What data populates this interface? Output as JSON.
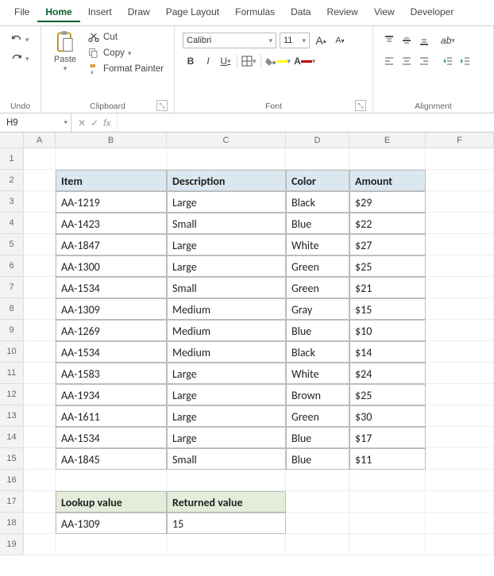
{
  "menu": {
    "tabs": [
      "File",
      "Home",
      "Insert",
      "Draw",
      "Page Layout",
      "Formulas",
      "Data",
      "Review",
      "View",
      "Developer"
    ],
    "active": "Home"
  },
  "ribbon": {
    "undo": {
      "label": "Undo"
    },
    "clipboard": {
      "paste": "Paste",
      "cut": "Cut",
      "copy": "Copy",
      "format_painter": "Format Painter",
      "label": "Clipboard"
    },
    "font": {
      "name": "Calibri",
      "size": "11",
      "label": "Font",
      "fill_color": "#ffff00",
      "font_color": "#c00000"
    },
    "alignment": {
      "label": "Alignment"
    }
  },
  "formula_bar": {
    "name_box": "H9",
    "fx": "fx",
    "value": ""
  },
  "columns": [
    "A",
    "B",
    "C",
    "D",
    "E",
    "F"
  ],
  "rows": [
    "1",
    "2",
    "3",
    "4",
    "5",
    "6",
    "7",
    "8",
    "9",
    "10",
    "11",
    "12",
    "13",
    "14",
    "15",
    "16",
    "17",
    "18",
    "19"
  ],
  "table_headers": [
    "Item",
    "Description",
    "Color",
    "Amount"
  ],
  "table": [
    [
      "AA-1219",
      "Large",
      "Black",
      "$29"
    ],
    [
      "AA-1423",
      "Small",
      "Blue",
      "$22"
    ],
    [
      "AA-1847",
      "Large",
      "White",
      "$27"
    ],
    [
      "AA-1300",
      "Large",
      "Green",
      "$25"
    ],
    [
      "AA-1534",
      "Small",
      "Green",
      "$21"
    ],
    [
      "AA-1309",
      "Medium",
      "Gray",
      "$15"
    ],
    [
      "AA-1269",
      "Medium",
      "Blue",
      "$10"
    ],
    [
      "AA-1534",
      "Medium",
      "Black",
      "$14"
    ],
    [
      "AA-1583",
      "Large",
      "White",
      "$24"
    ],
    [
      "AA-1934",
      "Large",
      "Brown",
      "$25"
    ],
    [
      "AA-1611",
      "Large",
      "Green",
      "$30"
    ],
    [
      "AA-1534",
      "Large",
      "Blue",
      "$17"
    ],
    [
      "AA-1845",
      "Small",
      "Blue",
      "$11"
    ]
  ],
  "lookup": {
    "headers": [
      "Lookup value",
      "Returned value"
    ],
    "values": [
      "AA-1309",
      "15"
    ]
  }
}
